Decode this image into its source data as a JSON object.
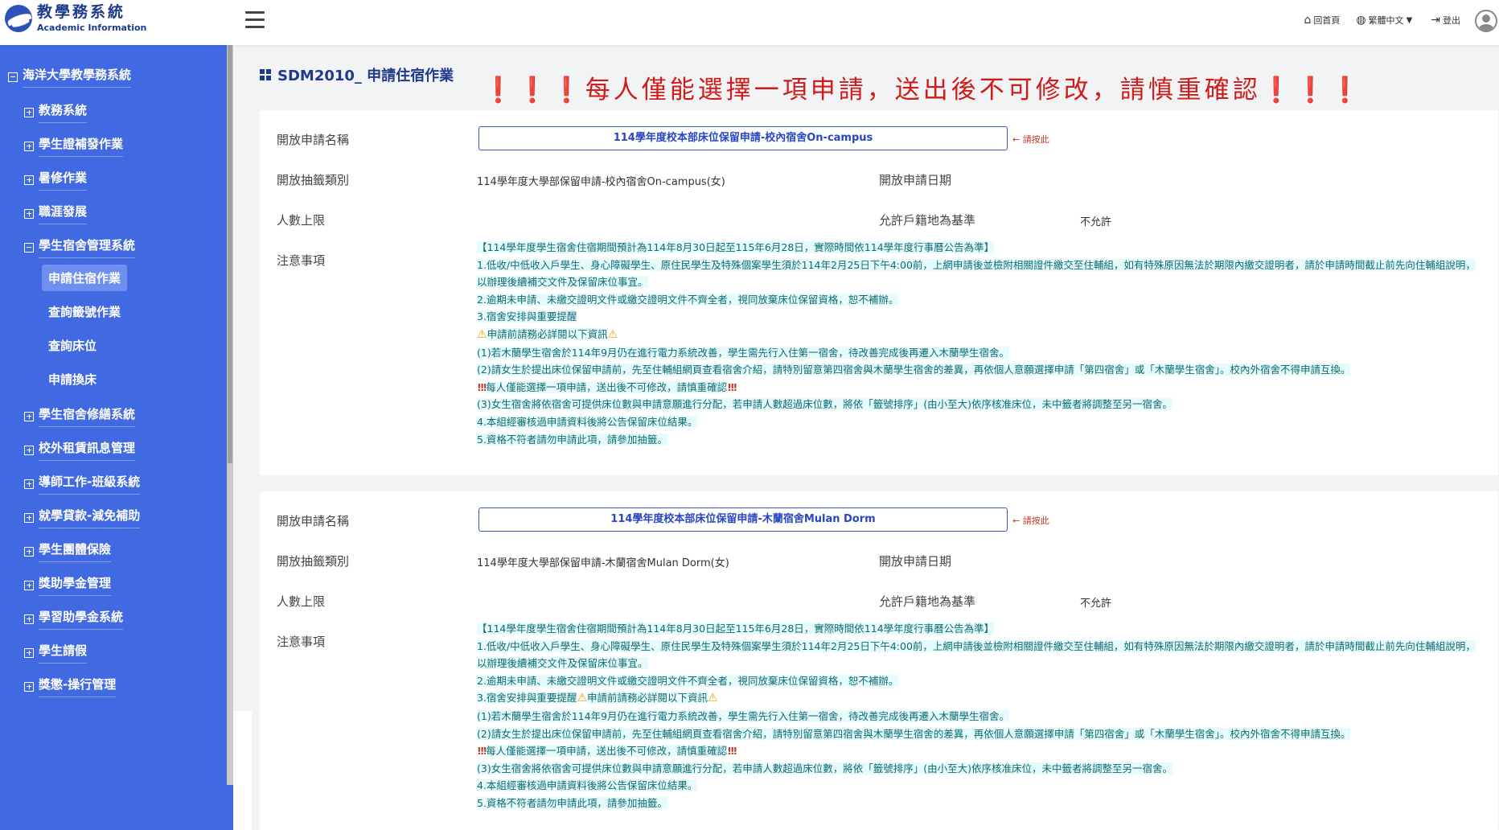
{
  "app": {
    "title": "教學務系統",
    "subtitle": "Academic Information"
  },
  "topnav": {
    "home": "回首頁",
    "language": "繁體中文",
    "logout": "登出"
  },
  "sidebar": {
    "root": "海洋大學教學務系統",
    "items": [
      {
        "label": "教務系統"
      },
      {
        "label": "學生證補發作業"
      },
      {
        "label": "暑修作業"
      },
      {
        "label": "職涯發展"
      },
      {
        "label": "學生宿舍管理系統"
      },
      {
        "label": "學生宿舍修繕系統"
      },
      {
        "label": "校外租賃訊息管理"
      },
      {
        "label": "導師工作-班級系統"
      },
      {
        "label": "就學貸款-減免補助"
      },
      {
        "label": "學生團體保險"
      },
      {
        "label": "獎助學金管理"
      },
      {
        "label": "學習助學金系統"
      },
      {
        "label": "學生請假"
      },
      {
        "label": "獎懲-操行管理"
      }
    ],
    "dorm_sub": [
      {
        "label": "申請住宿作業"
      },
      {
        "label": "查詢籤號作業"
      },
      {
        "label": "查詢床位"
      },
      {
        "label": "申請換床"
      }
    ]
  },
  "page": {
    "title": "SDM2010_ 申請住宿作業",
    "warning": "❗❗❗每人僅能選擇一項申請，送出後不可修改，請慎重確認❗❗❗"
  },
  "labels": {
    "open_name": "開放申請名稱",
    "lottery_type": "開放抽籤類別",
    "open_date": "開放申請日期",
    "capacity": "人數上限",
    "household_basis": "允許戶籍地為基準",
    "notes": "注意事項",
    "click_hint": "← 請按此"
  },
  "cards": [
    {
      "button": "114學年度校本部床位保留申請-校內宿舍On-campus",
      "lottery_type": "114學年度大學部保留申請-校內宿舍On-campus(女)",
      "open_date": "",
      "capacity": "",
      "household": "不允許",
      "notes": {
        "header": "【114學年度學生宿舍住宿期間預計為114年8月30日起至115年6月28日，實際時間依114學年度行事曆公告為準】",
        "n1": "1.低收/中低收入戶學生、身心障礙學生、原住民學生及特殊個案學生須於114年2月25日下午4:00前，上網申請後並檢附相關證件繳交至住輔組，如有特殊原因無法於期限內繳交證明者，請於申請時間截止前先向住輔組說明，以辦理後續補交文件及保留床位事宜。",
        "n2": "2.逾期未申請、未繳交證明文件或繳交證明文件不齊全者，視同放棄床位保留資格，恕不補辦。",
        "n3": "3.宿舍安排與重要提醒",
        "must_read": "申請前請務必詳閱以下資訊",
        "p1": "(1)若木蘭學生宿舍於114年9月仍在進行電力系統改善，學生需先行入住第一宿舍，待改善完成後再遷入木蘭學生宿舍。",
        "p2": "(2)請女生於提出床位保留申請前，先至住輔組網頁查看宿舍介紹，請特別留意第四宿舍與木蘭學生宿舍的差異，再依個人意願選擇申請「第四宿舍」或「木蘭學生宿舍」。校內外宿舍不得申請互換。",
        "one_only": "每人僅能選擇一項申請，送出後不可修改，請慎重確認",
        "p3": "(3)女生宿舍將依宿舍可提供床位數與申請意願進行分配，若申請人數超過床位數，將依「籤號排序」(由小至大)依序核准床位，未中籤者將調整至另一宿舍。",
        "n4": "4.本組經審核過申請資料後將公告保留床位結果。",
        "n5": "5.資格不符者請勿申請此項，請參加抽籤。"
      }
    },
    {
      "button": "114學年度校本部床位保留申請-木蘭宿舍Mulan Dorm",
      "lottery_type": "114學年度大學部保留申請-木蘭宿舍Mulan Dorm(女)",
      "open_date": "",
      "capacity": "",
      "household": "不允許",
      "notes": {
        "header": "【114學年度學生宿舍住宿期間預計為114年8月30日起至115年6月28日，實際時間依114學年度行事曆公告為準】",
        "n1": "1.低收/中低收入戶學生、身心障礙學生、原住民學生及特殊個案學生須於114年2月25日下午4:00前，上網申請後並檢附相關證件繳交至住輔組，如有特殊原因無法於期限內繳交證明者，請於申請時間截止前先向住輔組說明，以辦理後續補交文件及保留床位事宜。",
        "n2": "2.逾期未申請、未繳交證明文件或繳交證明文件不齊全者，視同放棄床位保留資格，恕不補辦。",
        "n3": "3.宿舍安排與重要提醒",
        "must_read": "申請前請務必詳閱以下資訊",
        "p1": "(1)若木蘭學生宿舍於114年9月仍在進行電力系統改善，學生需先行入住第一宿舍，待改善完成後再遷入木蘭學生宿舍。",
        "p2": "(2)請女生於提出床位保留申請前，先至住輔組網頁查看宿舍介紹，請特別留意第四宿舍與木蘭學生宿舍的差異，再依個人意願選擇申請「第四宿舍」或「木蘭學生宿舍」。校內外宿舍不得申請互換。",
        "one_only": "每人僅能選擇一項申請，送出後不可修改，請慎重確認",
        "p3": "(3)女生宿舍將依宿舍可提供床位數與申請意願進行分配，若申請人數超過床位數，將依「籤號排序」(由小至大)依序核准床位，未中籤者將調整至另一宿舍。",
        "n4": "4.本組經審核過申請資料後將公告保留床位結果。",
        "n5": "5.資格不符者請勿申請此項，請參加抽籤。"
      }
    }
  ]
}
